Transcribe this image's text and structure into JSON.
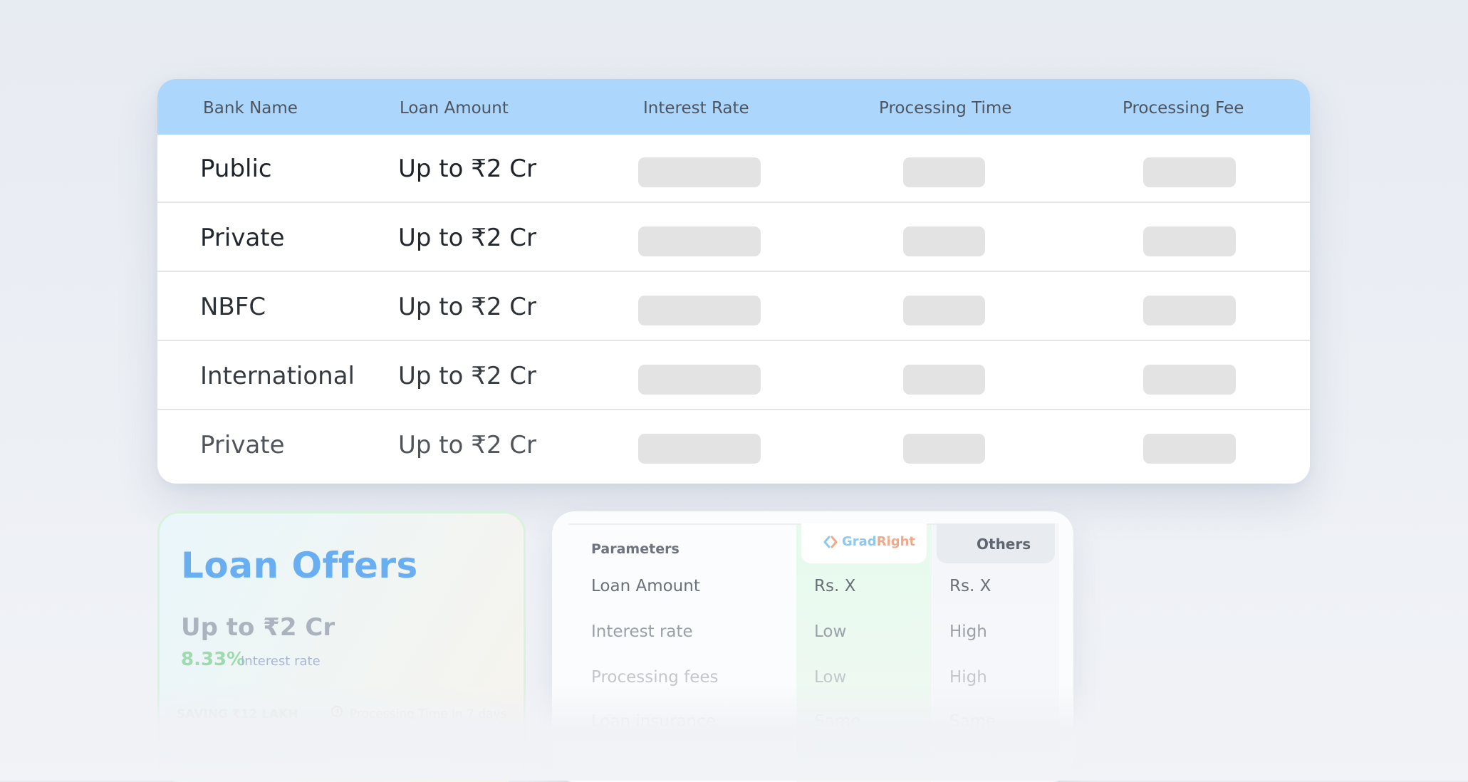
{
  "bank_table": {
    "headers": {
      "bank_name": "Bank Name",
      "loan_amount": "Loan Amount",
      "interest_rate": "Interest Rate",
      "processing_time": "Processing Time",
      "processing_fee": "Processing Fee"
    },
    "rows": [
      {
        "bank": "Public",
        "amount": "Up to ₹2 Cr"
      },
      {
        "bank": "Private",
        "amount": "Up to ₹2 Cr"
      },
      {
        "bank": "NBFC",
        "amount": "Up to ₹2 Cr"
      },
      {
        "bank": "International",
        "amount": "Up to ₹2 Cr"
      },
      {
        "bank": "Private",
        "amount": "Up to ₹2 Cr"
      }
    ]
  },
  "loan_offers": {
    "title": "Loan Offers",
    "amount": "Up to ₹2 Cr",
    "rate": "8.33%",
    "rate_label": "Interest rate",
    "saving": "SAVING ₹12 LAKH",
    "processing_time": "Processing Time in 7 days"
  },
  "comparison": {
    "parameters_label": "Parameters",
    "gradright_logo": {
      "part1": "Grad",
      "part2": "Right"
    },
    "others_label": "Others",
    "rows": [
      {
        "label": "Loan Amount",
        "gradright": "Rs. X",
        "others": "Rs. X"
      },
      {
        "label": "Interest rate",
        "gradright": "Low",
        "others": "High"
      },
      {
        "label": "Processing fees",
        "gradright": "Low",
        "others": "High"
      },
      {
        "label": "Loan insurance",
        "gradright": "Same",
        "others": "Same"
      }
    ]
  },
  "colors": {
    "header_blue": "#acd6fb",
    "loan_offers_title": "#6aaef2",
    "rate_green": "#9fd9ae",
    "gradright_blue": "#8ec8ea",
    "gradright_orange": "#f0a98b",
    "placeholder_gray": "#e3e3e3"
  },
  "icons": {
    "gradright_logo": "gradright-chevrons-icon",
    "processing_time": "clock-icon"
  }
}
